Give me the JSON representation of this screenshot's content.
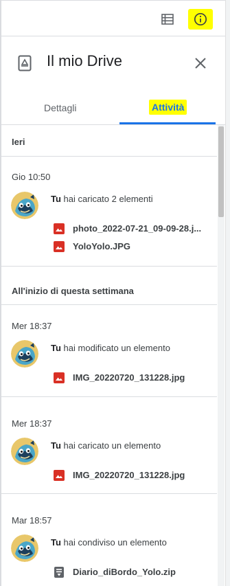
{
  "toolbar": {
    "list_view_icon": "list-view-icon",
    "info_icon": "info-icon",
    "highlight_color": "#ffff00"
  },
  "panel": {
    "title": "Il mio Drive",
    "title_icon": "drive-icon",
    "close_icon": "close-icon"
  },
  "tabs": [
    {
      "label": "Dettagli",
      "active": false
    },
    {
      "label": "Attività",
      "active": true
    }
  ],
  "accent_color": "#1a73e8",
  "sections": [
    {
      "header": "Ieri",
      "activities": [
        {
          "time": "Gio 10:50",
          "actor": "Tu",
          "action": "hai caricato 2 elementi",
          "files": [
            {
              "name": "photo_2022-07-21_09-09-28.j...",
              "icon": "image-file-icon"
            },
            {
              "name": "YoloYolo.JPG",
              "icon": "image-file-icon"
            }
          ]
        }
      ]
    },
    {
      "header": "All'inizio di questa settimana",
      "activities": [
        {
          "time": "Mer 18:37",
          "actor": "Tu",
          "action": "hai modificato un elemento",
          "files": [
            {
              "name": "IMG_20220720_131228.jpg",
              "icon": "image-file-icon"
            }
          ]
        },
        {
          "time": "Mer 18:37",
          "actor": "Tu",
          "action": "hai caricato un elemento",
          "files": [
            {
              "name": "IMG_20220720_131228.jpg",
              "icon": "image-file-icon"
            }
          ]
        },
        {
          "time": "Mar 18:57",
          "actor": "Tu",
          "action": "hai condiviso un elemento",
          "files": [
            {
              "name": "Diario_diBordo_Yolo.zip",
              "icon": "zip-file-icon"
            }
          ]
        }
      ]
    }
  ]
}
